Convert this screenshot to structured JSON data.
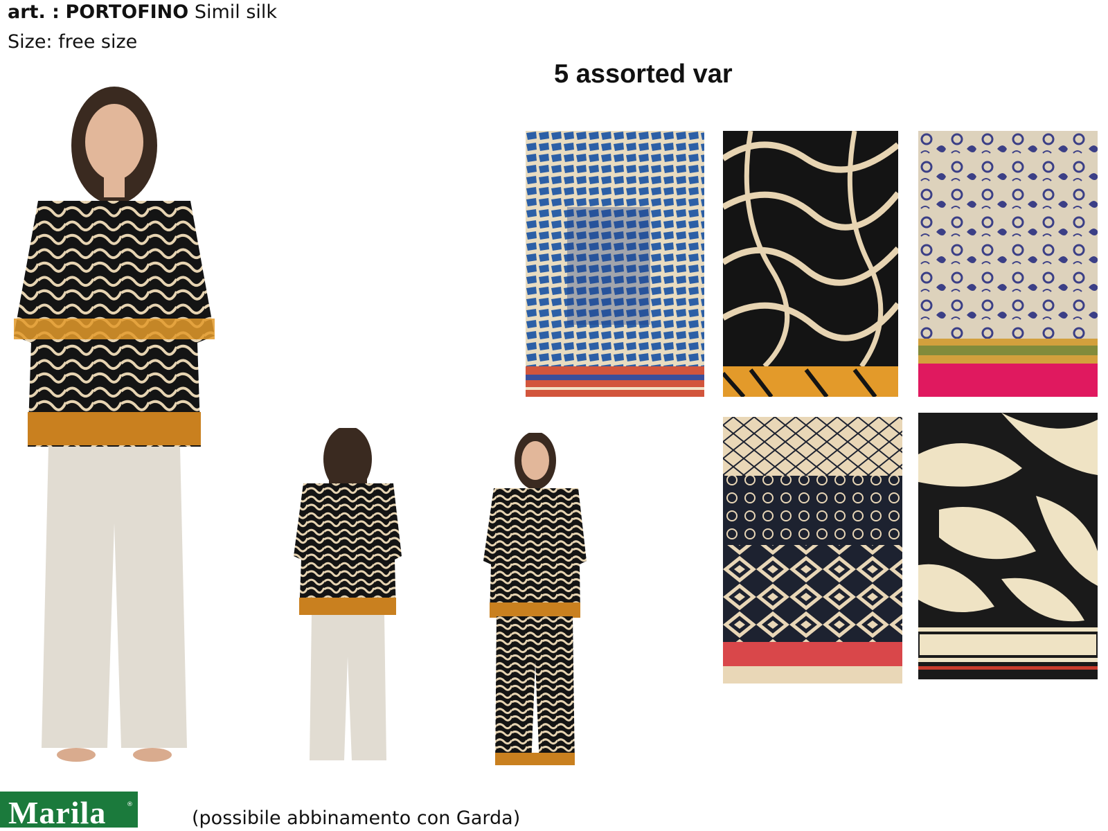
{
  "header": {
    "art_prefix": "art. :",
    "art_name": "PORTOFINO",
    "fabric": "Simil silk",
    "size": "Size: free size"
  },
  "variants_title": "5 assorted var",
  "caption": "(possibile abbinamento con Garda)",
  "brand": {
    "logo_text": "Marila",
    "registered_mark": "®",
    "color": "#1b7a3c"
  },
  "swatches": [
    {
      "pattern": "blue-scales",
      "colors": [
        "#2c5fa6",
        "#e9dcc0",
        "#d2553c"
      ]
    },
    {
      "pattern": "black-zebra",
      "colors": [
        "#141414",
        "#e7d4b2",
        "#e39a2a"
      ]
    },
    {
      "pattern": "navy-paisley",
      "colors": [
        "#3b3f86",
        "#ddd2bc",
        "#e0195f"
      ]
    },
    {
      "pattern": "geometric-bands",
      "colors": [
        "#1d2230",
        "#e9d7b7",
        "#d9474a"
      ]
    },
    {
      "pattern": "black-leaves",
      "colors": [
        "#1a1a1a",
        "#efe3c4",
        "#c83b2c"
      ]
    }
  ],
  "models": [
    {
      "view": "front-with-pants",
      "top": "black-zebra",
      "pants": "beige"
    },
    {
      "view": "back-with-pants",
      "top": "black-zebra",
      "pants": "beige"
    },
    {
      "view": "front-matching-set",
      "top": "black-zebra",
      "pants": "black-zebra"
    }
  ]
}
